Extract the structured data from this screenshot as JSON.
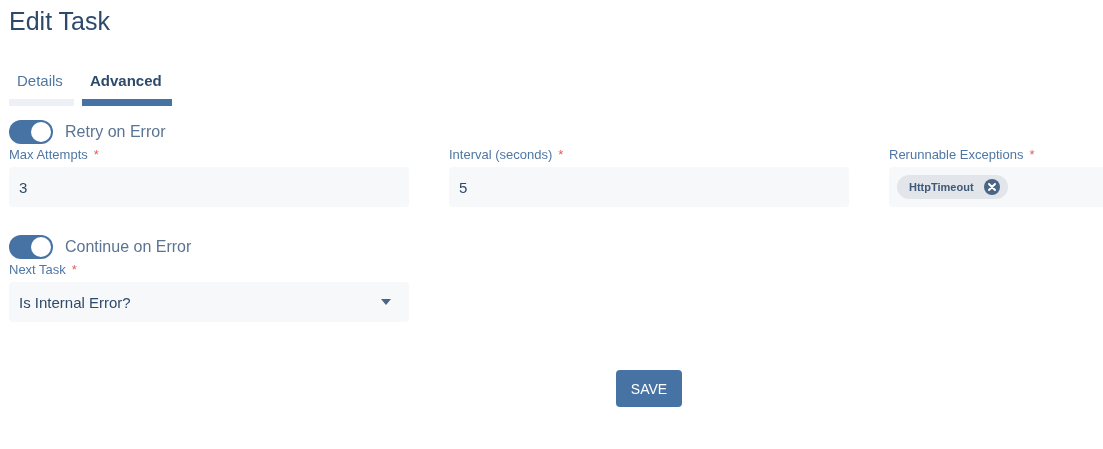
{
  "title": "Edit Task",
  "tabs": [
    {
      "label": "Details",
      "selected": false
    },
    {
      "label": "Advanced",
      "selected": true
    }
  ],
  "sections": [
    {
      "toggle": {
        "label": "Retry on Error",
        "on": true
      },
      "fields": [
        {
          "kind": "text",
          "label": "Max Attempts",
          "required_mark": "*",
          "value": "3"
        },
        {
          "kind": "text",
          "label": "Interval (seconds)",
          "required_mark": "*",
          "value": "5"
        },
        {
          "kind": "tags",
          "label": "Rerunnable Exceptions",
          "required_mark": "*",
          "tags": [
            "HttpTimeout"
          ]
        }
      ]
    },
    {
      "toggle": {
        "label": "Continue on Error",
        "on": true
      },
      "fields": [
        {
          "kind": "select",
          "label": "Next Task",
          "required_mark": "*",
          "value": "Is Internal Error?"
        }
      ]
    }
  ],
  "save_button": "SAVE"
}
